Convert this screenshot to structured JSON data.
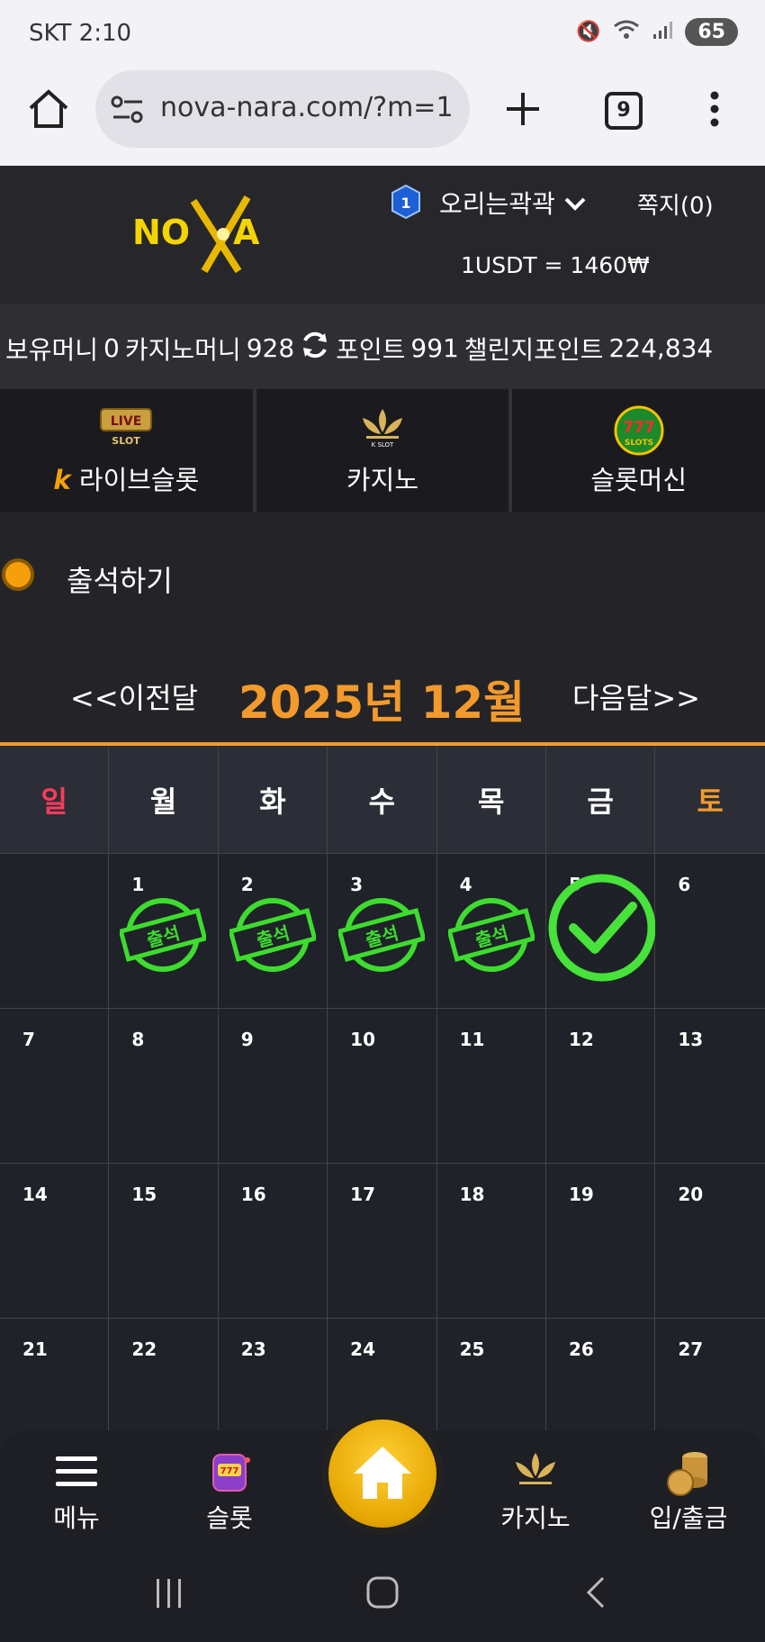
{
  "status_bar": {
    "carrier_time": "SKT 2:10",
    "battery": "65"
  },
  "browser": {
    "url": "nova-nara.com/?m=1",
    "tab_count": "9"
  },
  "header": {
    "logo_text": "NOVA",
    "username": "오리는곽곽",
    "messages": "쪽지(0)",
    "rate": "1USDT = 1460₩"
  },
  "balances": {
    "holding_label": "보유머니",
    "holding_value": "0",
    "casino_label": "카지노머니",
    "casino_value": "928",
    "point_label": "포인트",
    "point_value": "991",
    "challenge_label": "챌린지포인트",
    "challenge_value": "224,834"
  },
  "categories": [
    {
      "label": "라이브슬롯",
      "icon": "live-slot-icon"
    },
    {
      "label": "카지노",
      "icon": "kslot-lotus-icon"
    },
    {
      "label": "슬롯머신",
      "icon": "777-slots-icon"
    }
  ],
  "attendance": {
    "title": "출석하기",
    "prev": "<<이전달",
    "next": "다음달>>",
    "month_title": "2025년 12월",
    "weekdays": [
      "일",
      "월",
      "화",
      "수",
      "목",
      "금",
      "토"
    ],
    "stamp_text": "출석",
    "weeks": [
      [
        {
          "day": "",
          "mark": ""
        },
        {
          "day": "1",
          "mark": "stamp"
        },
        {
          "day": "2",
          "mark": "stamp"
        },
        {
          "day": "3",
          "mark": "stamp"
        },
        {
          "day": "4",
          "mark": "stamp"
        },
        {
          "day": "5",
          "mark": "check"
        },
        {
          "day": "6",
          "mark": ""
        }
      ],
      [
        {
          "day": "7"
        },
        {
          "day": "8"
        },
        {
          "day": "9"
        },
        {
          "day": "10"
        },
        {
          "day": "11"
        },
        {
          "day": "12"
        },
        {
          "day": "13"
        }
      ],
      [
        {
          "day": "14"
        },
        {
          "day": "15"
        },
        {
          "day": "16"
        },
        {
          "day": "17"
        },
        {
          "day": "18"
        },
        {
          "day": "19"
        },
        {
          "day": "20"
        }
      ],
      [
        {
          "day": "21"
        },
        {
          "day": "22"
        },
        {
          "day": "23"
        },
        {
          "day": "24"
        },
        {
          "day": "25"
        },
        {
          "day": "26"
        },
        {
          "day": "27"
        }
      ]
    ]
  },
  "bottom_nav": {
    "menu": "메뉴",
    "slot": "슬롯",
    "casino": "카지노",
    "deposit": "입/출금"
  },
  "colors": {
    "accent": "#f39a2c",
    "sunday": "#ff3b5c",
    "stamp": "#3ddc2f"
  }
}
